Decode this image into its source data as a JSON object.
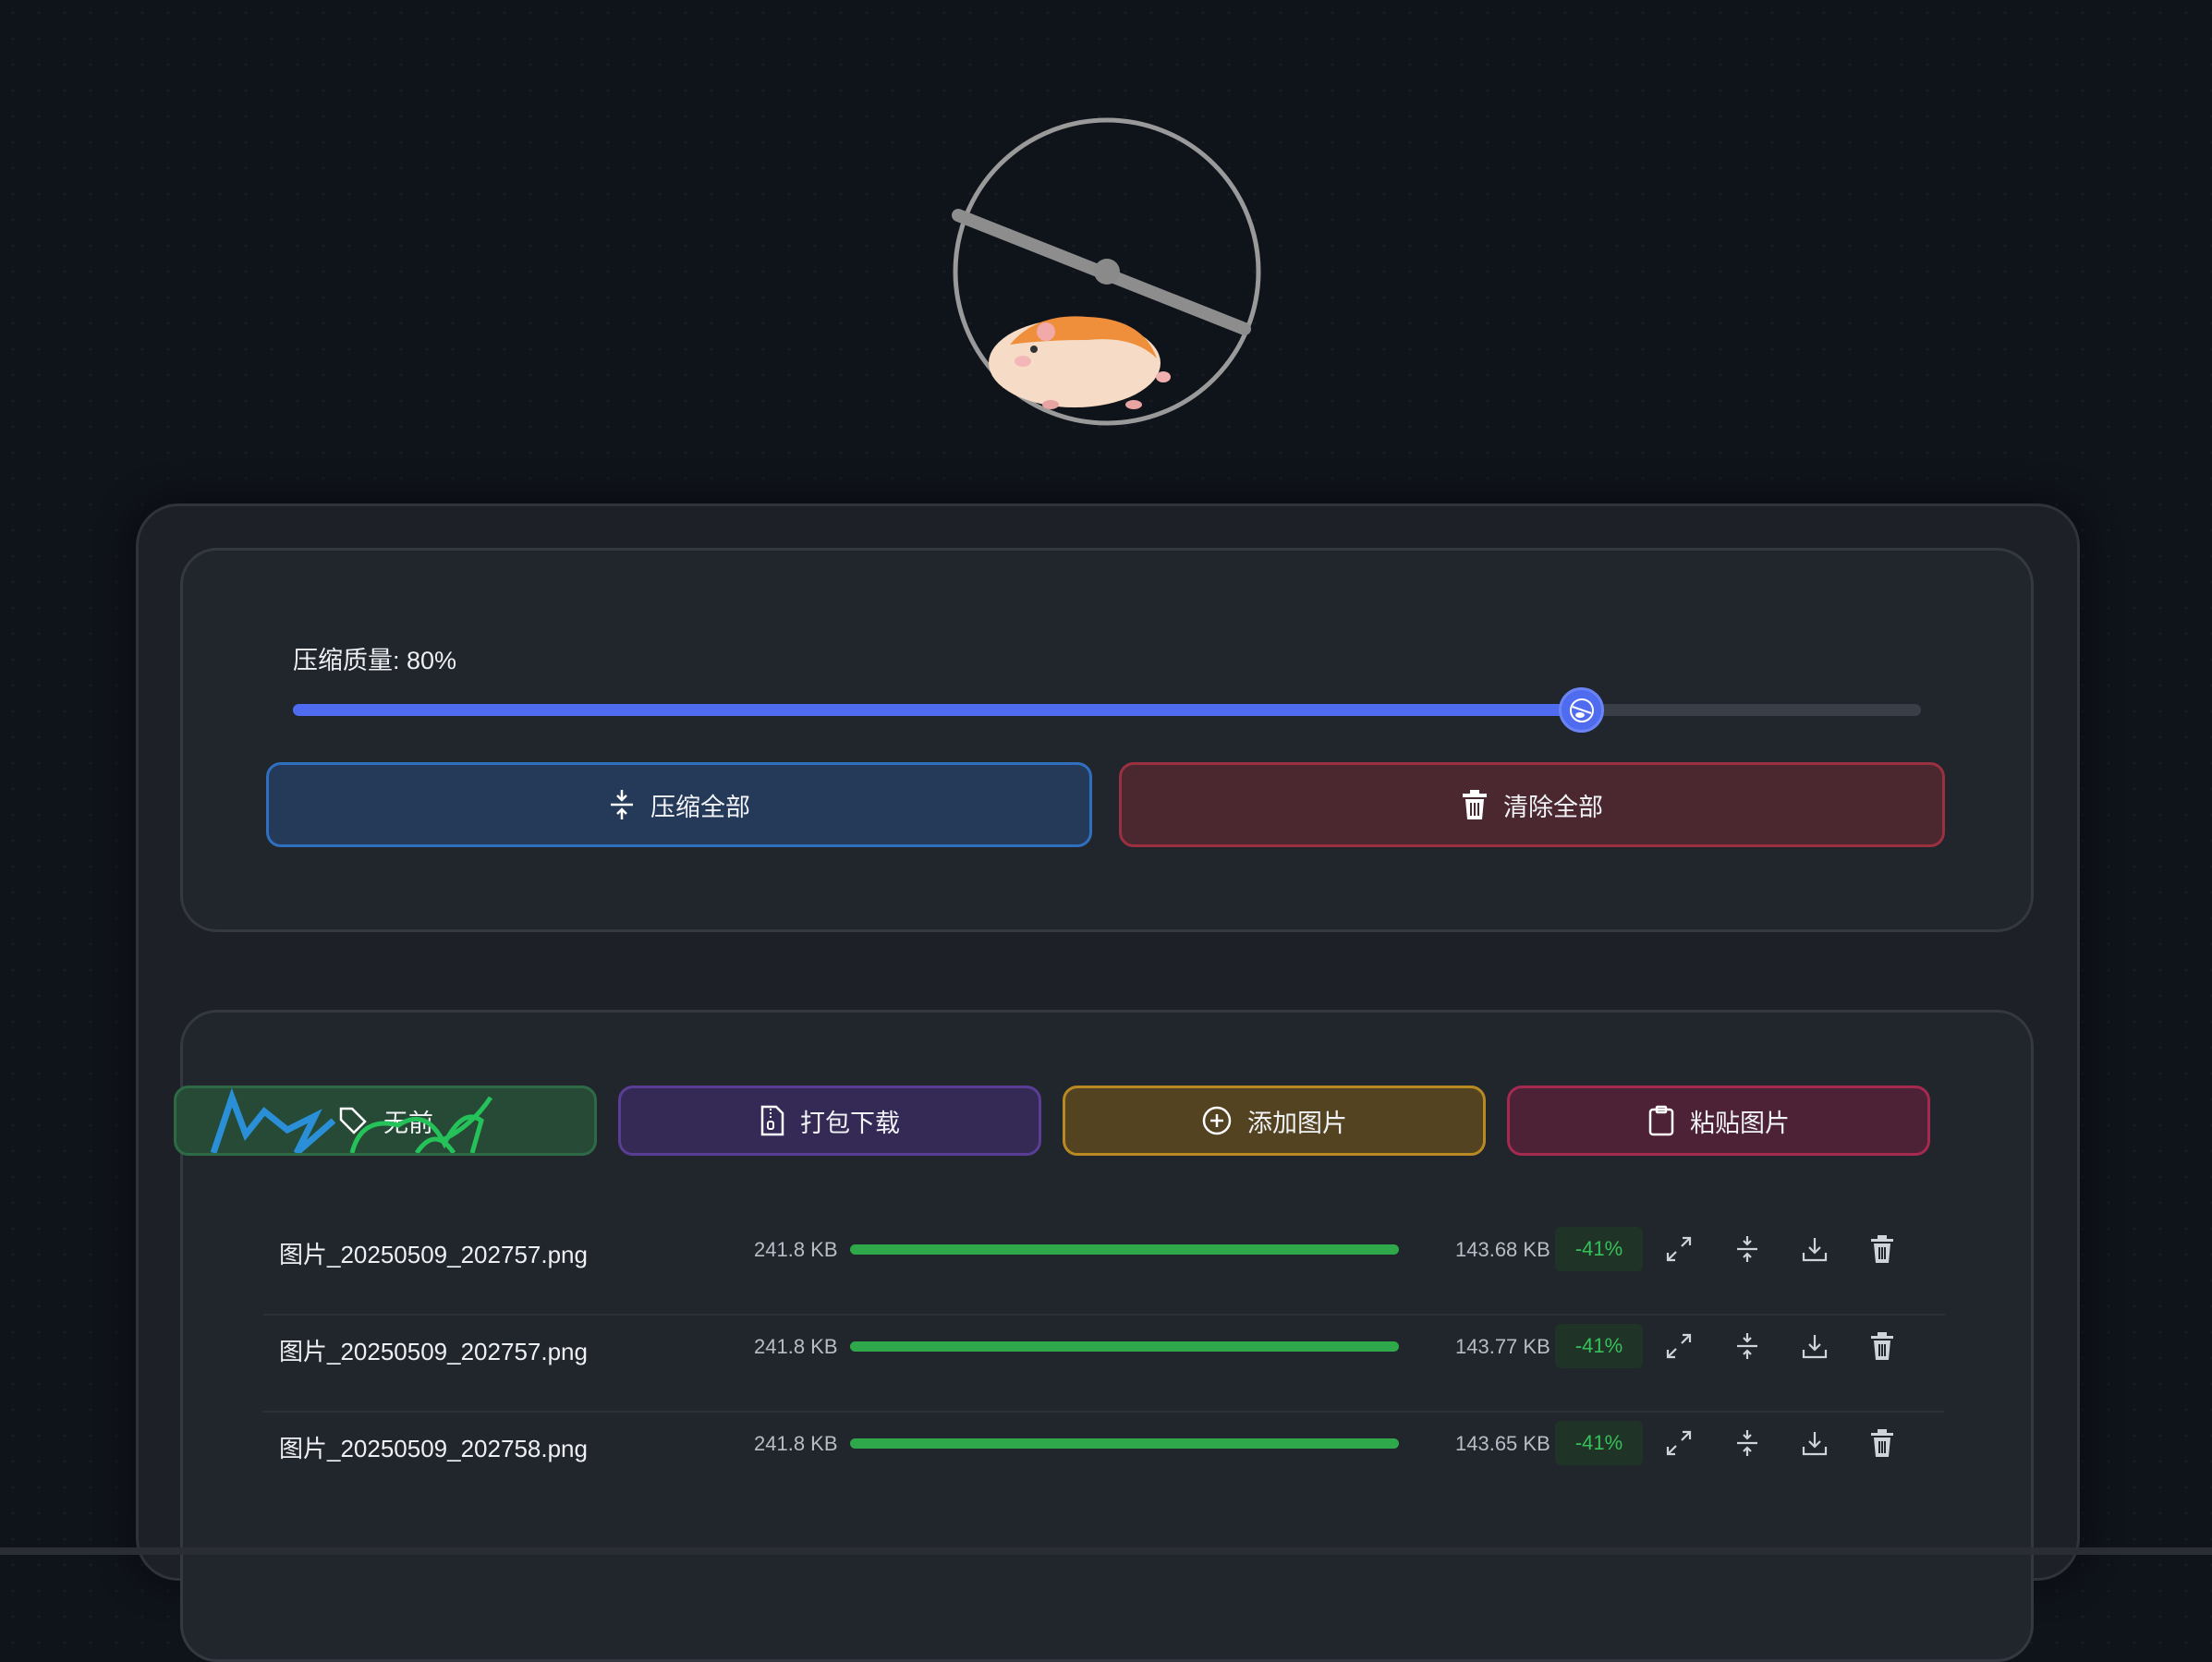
{
  "logo": {
    "name": "hamster-wheel-logo"
  },
  "settings": {
    "quality_label": "压缩质量: 80%",
    "quality_value": 0.8,
    "compress_all_label": "压缩全部",
    "clear_all_label": "清除全部"
  },
  "actions": {
    "compare_label": "无前",
    "zip_download_label": "打包下载",
    "add_image_label": "添加图片",
    "paste_image_label": "粘贴图片"
  },
  "files": [
    {
      "name": "图片_20250509_202757.png",
      "original_size": "241.8 KB",
      "progress": 1.0,
      "compressed_size": "143.68 KB",
      "reduction": "-41%"
    },
    {
      "name": "图片_20250509_202757.png",
      "original_size": "241.8 KB",
      "progress": 1.0,
      "compressed_size": "143.77 KB",
      "reduction": "-41%"
    },
    {
      "name": "图片_20250509_202758.png",
      "original_size": "241.8 KB",
      "progress": 1.0,
      "compressed_size": "143.65 KB",
      "reduction": "-41%"
    }
  ],
  "row_icons": [
    "expand-icon",
    "compress-icon",
    "download-icon",
    "trash-icon"
  ],
  "colors": {
    "accent": "#4f6cf0",
    "success": "#2ea84a",
    "danger": "#9b3040"
  }
}
